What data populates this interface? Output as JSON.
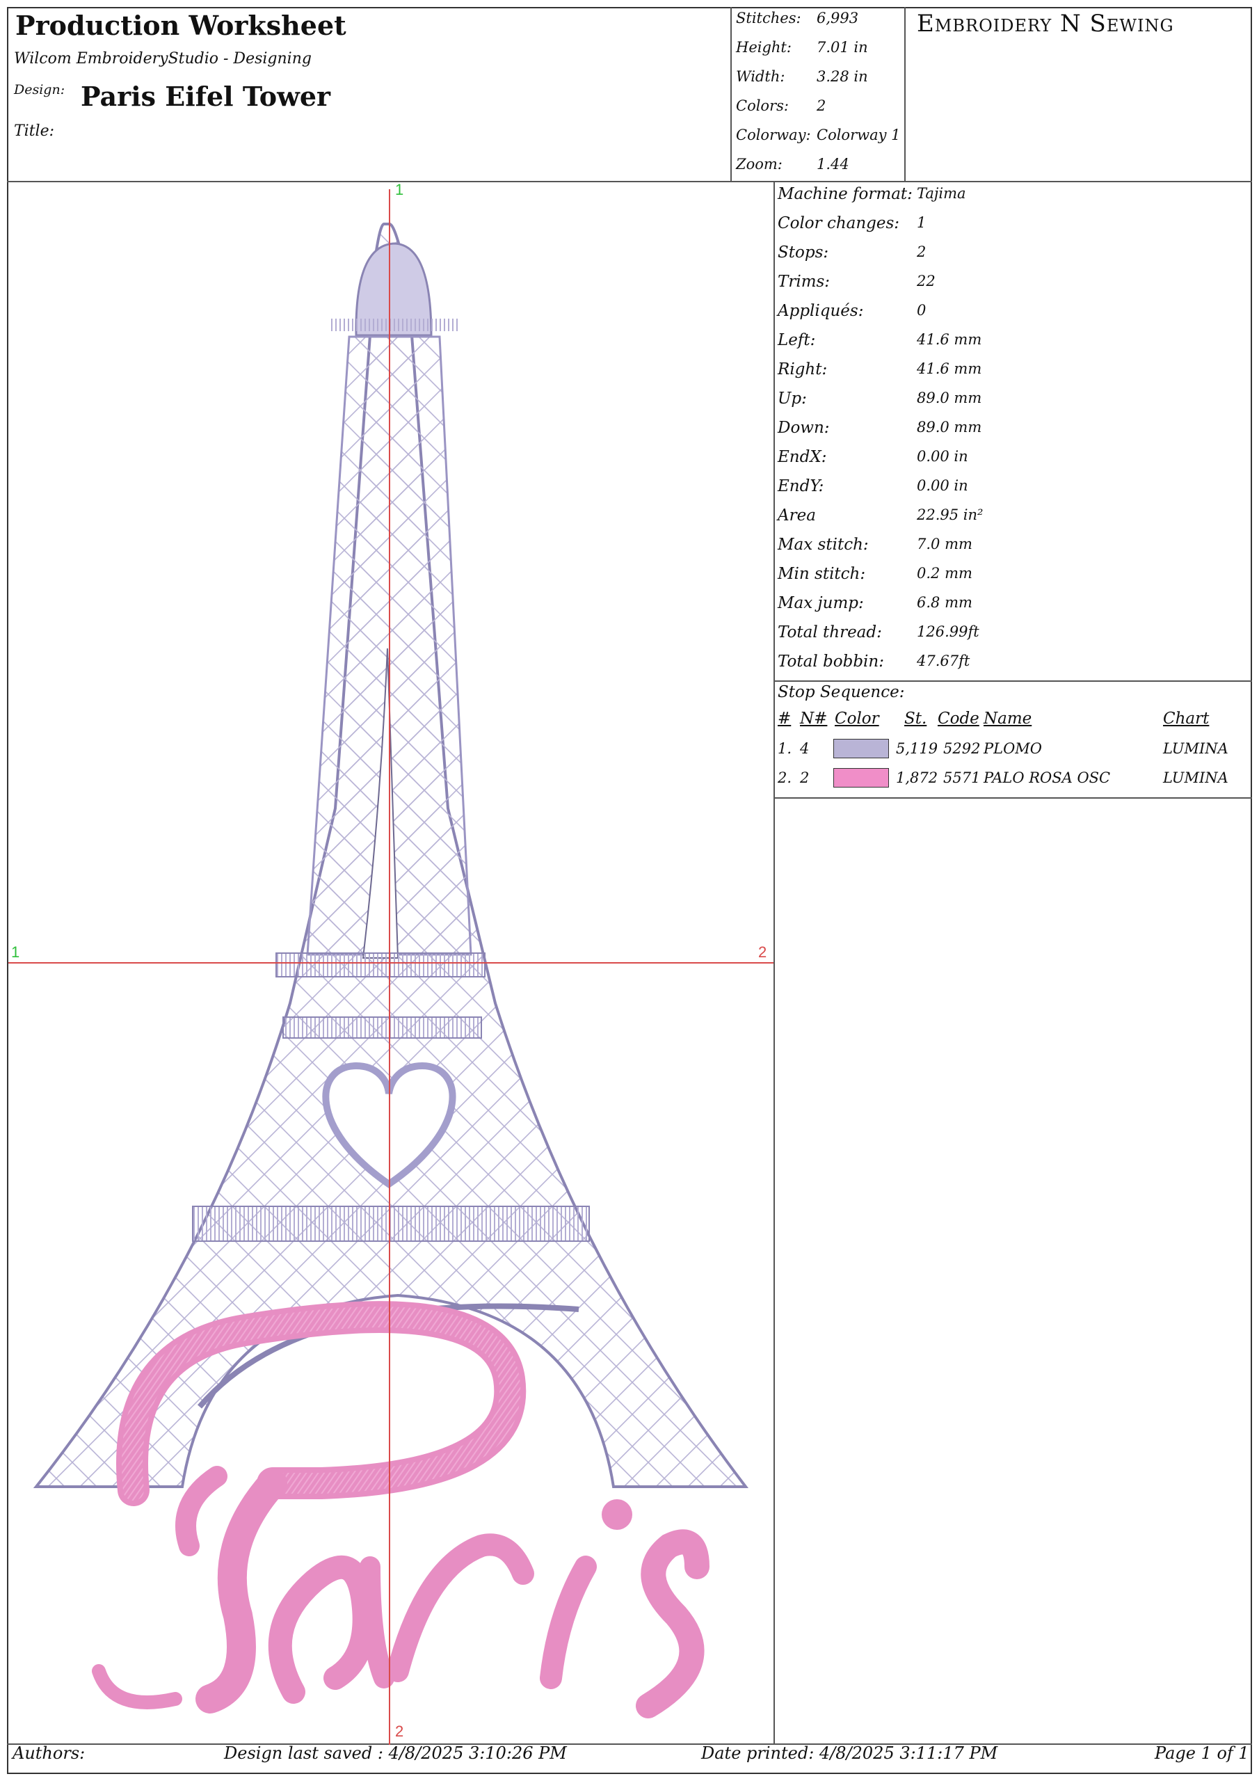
{
  "header": {
    "title": "Production Worksheet",
    "software": "Wilcom EmbroideryStudio - Designing",
    "design_label": "Design:",
    "design_name": "Paris Eifel Tower",
    "title_label": "Title:",
    "brand": "Embroidery N Sewing"
  },
  "stats": [
    {
      "label": "Stitches:",
      "value": "6,993"
    },
    {
      "label": "Height:",
      "value": "7.01  in"
    },
    {
      "label": "Width:",
      "value": "3.28  in"
    },
    {
      "label": "Colors:",
      "value": "2"
    },
    {
      "label": "Colorway:",
      "value": "Colorway 1"
    },
    {
      "label": "Zoom:",
      "value": "1.44"
    }
  ],
  "machine": [
    {
      "label": "Machine format:",
      "value": "Tajima"
    },
    {
      "label": "Color changes:",
      "value": "1"
    },
    {
      "label": "Stops:",
      "value": "2"
    },
    {
      "label": "Trims:",
      "value": "22"
    },
    {
      "label": "Appliqués:",
      "value": "0"
    },
    {
      "label": "Left:",
      "value": "41.6  mm"
    },
    {
      "label": "Right:",
      "value": "41.6  mm"
    },
    {
      "label": "Up:",
      "value": "89.0  mm"
    },
    {
      "label": "Down:",
      "value": "89.0  mm"
    },
    {
      "label": "EndX:",
      "value": "0.00  in"
    },
    {
      "label": "EndY:",
      "value": "0.00  in"
    },
    {
      "label": "Area",
      "value": "22.95  in²"
    },
    {
      "label": "Max stitch:",
      "value": "7.0  mm"
    },
    {
      "label": "Min stitch:",
      "value": "0.2  mm"
    },
    {
      "label": "Max jump:",
      "value": "6.8  mm"
    },
    {
      "label": "Total thread:",
      "value": "126.99ft"
    },
    {
      "label": "Total bobbin:",
      "value": "47.67ft"
    }
  ],
  "stop_sequence": {
    "title": "Stop Sequence:",
    "columns": [
      "#",
      "N#",
      "Color",
      "St.",
      "Code",
      "Name",
      "Chart"
    ],
    "rows": [
      {
        "num": "1.",
        "n": "4",
        "color": "#b9b4d6",
        "st": "5,119",
        "code": "5292",
        "name": "PLOMO",
        "chart": "LUMINA"
      },
      {
        "num": "2.",
        "n": "2",
        "color": "#f08ec8",
        "st": "1,872",
        "code": "5571",
        "name": "PALO ROSA OSC",
        "chart": "LUMINA"
      }
    ]
  },
  "guides": {
    "top": "1",
    "left": "1",
    "right": "2",
    "bottom": "2"
  },
  "footer": {
    "authors": "Authors:",
    "saved": "Design last saved : 4/8/2025 3:10:26 PM",
    "printed": "Date printed: 4/8/2025 3:11:17 PM",
    "page": "Page 1 of 1"
  },
  "colors": {
    "thread1": "#b9b4d6",
    "thread2": "#f08ec8",
    "guide": "#d94a4a",
    "guide_label_green": "#2fbf3a"
  }
}
